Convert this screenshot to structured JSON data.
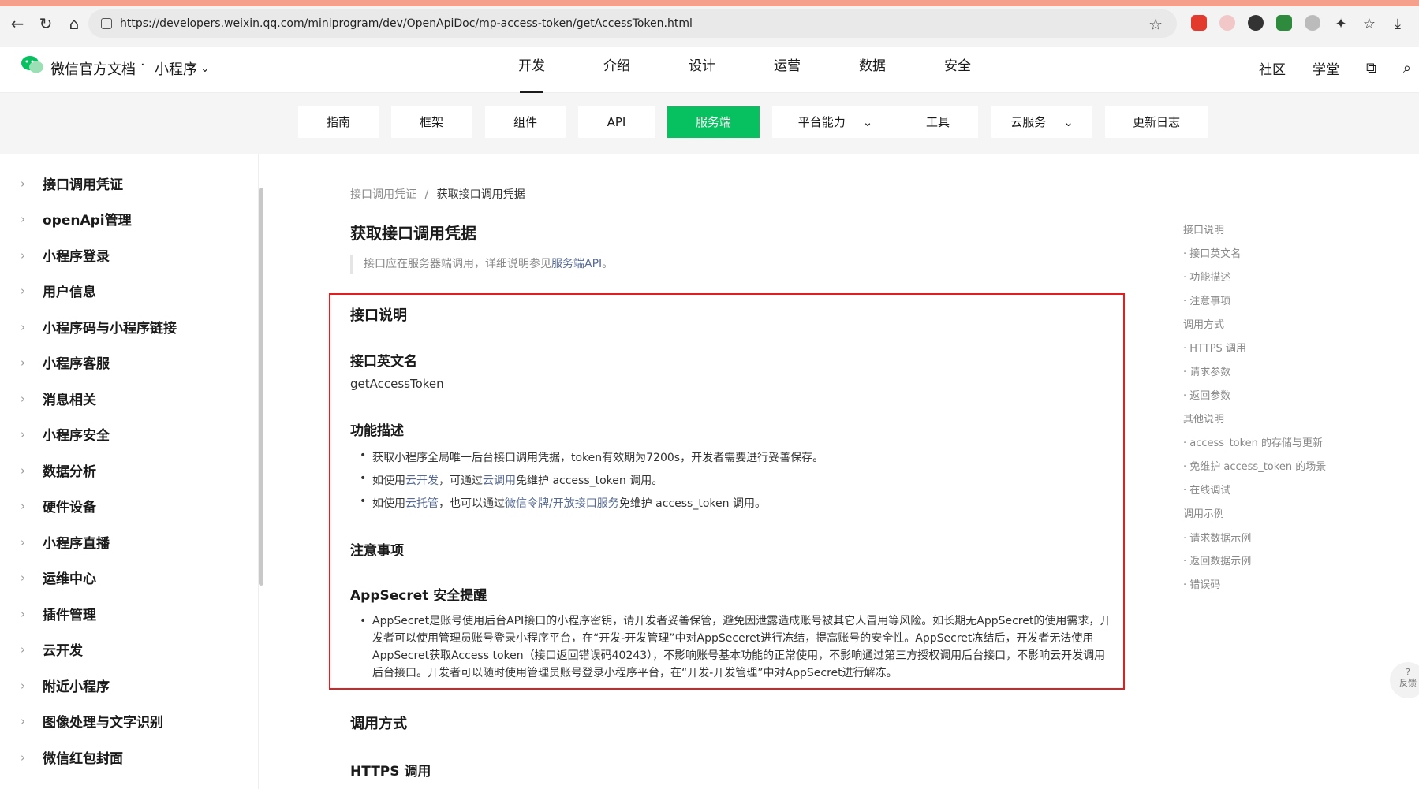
{
  "browser": {
    "url": "https://developers.weixin.qq.com/miniprogram/dev/OpenApiDoc/mp-access-token/getAccessToken.html"
  },
  "header": {
    "brand": "微信官方文档",
    "separator": "·",
    "product": "小程序",
    "nav": [
      "开发",
      "介绍",
      "设计",
      "运营",
      "数据",
      "安全"
    ],
    "right": [
      "社区",
      "学堂"
    ]
  },
  "subnav": {
    "items": [
      "指南",
      "框架",
      "组件",
      "API",
      "服务端",
      "平台能力",
      "工具",
      "云服务",
      "更新日志"
    ],
    "active": "服务端"
  },
  "sidebar": {
    "items": [
      "接口调用凭证",
      "openApi管理",
      "小程序登录",
      "用户信息",
      "小程序码与小程序链接",
      "小程序客服",
      "消息相关",
      "小程序安全",
      "数据分析",
      "硬件设备",
      "小程序直播",
      "运维中心",
      "插件管理",
      "云开发",
      "附近小程序",
      "图像处理与文字识别",
      "微信红包封面"
    ]
  },
  "breadcrumb": {
    "parent": "接口调用凭证",
    "separator": "/",
    "current": "获取接口调用凭据"
  },
  "main": {
    "title": "获取接口调用凭据",
    "note_prefix": "接口应在服务器端调用，详细说明参见",
    "note_link": "服务端API",
    "note_suffix": "。",
    "section_api_desc": "接口说明",
    "sub_api_name": "接口英文名",
    "api_name": "getAccessToken",
    "sub_feature": "功能描述",
    "feature_b1": "获取小程序全局唯一后台接口调用凭据，token有效期为7200s，开发者需要进行妥善保存。",
    "feature_b2_a": "如使用",
    "feature_b2_link1": "云开发",
    "feature_b2_b": "，可通过",
    "feature_b2_link2": "云调用",
    "feature_b2_c": "免维护 access_token 调用。",
    "feature_b3_a": "如使用",
    "feature_b3_link1": "云托管",
    "feature_b3_b": "，也可以通过",
    "feature_b3_link2": "微信令牌/开放接口服务",
    "feature_b3_c": "免维护 access_token 调用。",
    "sub_notes": "注意事项",
    "sub_appsecret": "AppSecret 安全提醒",
    "appsecret_text": "AppSecret是账号使用后台API接口的小程序密钥，请开发者妥善保管，避免因泄露造成账号被其它人冒用等风险。如长期无AppSecret的使用需求，开发者可以使用管理员账号登录小程序平台，在“开发-开发管理”中对AppSeceret进行冻结，提高账号的安全性。AppSecret冻结后，开发者无法使用AppSecret获取Access token（接口返回错误码40243），不影响账号基本功能的正常使用，不影响通过第三方授权调用后台接口，不影响云开发调用后台接口。开发者可以随时使用管理员账号登录小程序平台，在“开发-开发管理”中对AppSecret进行解冻。",
    "section_call": "调用方式",
    "sub_https": "HTTPS 调用"
  },
  "toc": [
    "接口说明",
    "· 接口英文名",
    "· 功能描述",
    "· 注意事项",
    "调用方式",
    "· HTTPS 调用",
    "· 请求参数",
    "· 返回参数",
    "其他说明",
    "· access_token 的存储与更新",
    "· 免维护 access_token 的场景",
    "· 在线调试",
    "调用示例",
    "· 请求数据示例",
    "· 返回数据示例",
    "· 错误码"
  ],
  "feedback": {
    "symbol": "?",
    "label": "反馈"
  },
  "colors": {
    "accent": "#07c160",
    "link": "#576b95",
    "highlight": "#e02020"
  }
}
